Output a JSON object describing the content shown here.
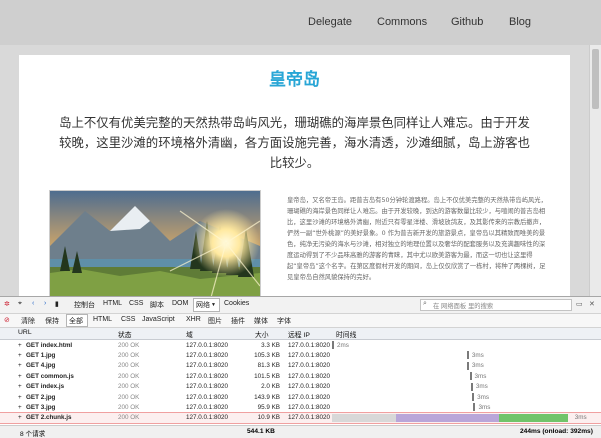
{
  "nav": {
    "items": [
      "Delegate",
      "Commons",
      "Github",
      "Blog"
    ]
  },
  "article": {
    "title": "皇帝岛",
    "lead": "岛上不仅有优美完整的天然热带岛屿风光，珊瑚礁的海岸景色同样让人难忘。由于开发较晚，这里沙滩的环境格外清幽，各方面设施完善，海水清透，沙滩细腻，岛上游客也比较少。",
    "body": "皇帝岛，又名帝王岛。距普吉岛有50分钟轮渡路程。岛上不仅优美完整的天然热带岛屿风光，珊瑚礁的海岸景色同样让人难忘。由于开发较晚，到达的游客数量比较少，与喧闹的普吉岛相比，这里沙滩的环境格外清幽，附近只有零星洋楼、滑坡放鸽友，及其影传来的宗教后撤声，俨然一副“世外桃源”的美好景象。0 作为普吉新开发的旅游景点，皇帝岛以其精致而唯美的景色，纯净无污染的海水与沙滩，相对独立的地理位置以及奢华的配套服务以及充满趣味性的深度运动得到了不少品味高雅的游客的青睐，其中尤以欧美游客为最，而这一切也让这里得起“皇帝岛”这个名字。在第区度假村开发的期间，岛上仅仅欣赏了一栋村，将种了两棵树，足见皇帝岛自然风貌保持的完好。",
    "image": "landscape-sunset-photo"
  },
  "devtools": {
    "toolbar": {
      "tabs": [
        "控制台",
        "HTML",
        "CSS",
        "脚本",
        "DOM",
        "网络",
        "Cookies"
      ],
      "active_tab": "网络",
      "search_placeholder": "在 网络面板 里的搜索"
    },
    "filter": {
      "actions": [
        "清除",
        "保持"
      ],
      "types": [
        "全部",
        "HTML",
        "CSS",
        "JavaScript",
        "XHR",
        "图片",
        "插件",
        "媒体",
        "字体"
      ],
      "active_type": "全部"
    },
    "columns": [
      "URL",
      "状态",
      "域",
      "大小",
      "远程 IP",
      "时间线"
    ],
    "requests": [
      {
        "url": "GET index.html",
        "status": "200 OK",
        "domain": "127.0.0.1:8020",
        "size": "3.3 KB",
        "ip": "127.0.0.1:8020",
        "time": "2ms",
        "start": 0.0,
        "dur": 0.01
      },
      {
        "url": "GET 1.jpg",
        "status": "200 OK",
        "domain": "127.0.0.1:8020",
        "size": "105.3 KB",
        "ip": "127.0.0.1:8020",
        "time": "3ms",
        "start": 0.515,
        "dur": 0.01
      },
      {
        "url": "GET 4.jpg",
        "status": "200 OK",
        "domain": "127.0.0.1:8020",
        "size": "81.3 KB",
        "ip": "127.0.0.1:8020",
        "time": "3ms",
        "start": 0.515,
        "dur": 0.01
      },
      {
        "url": "GET common.js",
        "status": "200 OK",
        "domain": "127.0.0.1:8020",
        "size": "101.5 KB",
        "ip": "127.0.0.1:8020",
        "time": "3ms",
        "start": 0.525,
        "dur": 0.01
      },
      {
        "url": "GET index.js",
        "status": "200 OK",
        "domain": "127.0.0.1:8020",
        "size": "2.0 KB",
        "ip": "127.0.0.1:8020",
        "time": "3ms",
        "start": 0.53,
        "dur": 0.01
      },
      {
        "url": "GET 2.jpg",
        "status": "200 OK",
        "domain": "127.0.0.1:8020",
        "size": "143.9 KB",
        "ip": "127.0.0.1:8020",
        "time": "3ms",
        "start": 0.535,
        "dur": 0.01
      },
      {
        "url": "GET 3.jpg",
        "status": "200 OK",
        "domain": "127.0.0.1:8020",
        "size": "95.9 KB",
        "ip": "127.0.0.1:8020",
        "time": "3ms",
        "start": 0.54,
        "dur": 0.01
      },
      {
        "url": "GET 2.chunk.js",
        "status": "200 OK",
        "domain": "127.0.0.1:8020",
        "size": "10.9 KB",
        "ip": "127.0.0.1:8020",
        "time": "3ms",
        "start": 0.0,
        "dur": 0.98,
        "selected": true
      }
    ],
    "footer": {
      "count": "8 个请求",
      "total_size": "544.1 KB",
      "timing": "244ms (onload: 392ms)"
    },
    "colors": {
      "waiting": "#b9a6d9",
      "receiving": "#71c46a",
      "blocking": "#d8d8d8",
      "marker": "#7a7a7a"
    }
  }
}
